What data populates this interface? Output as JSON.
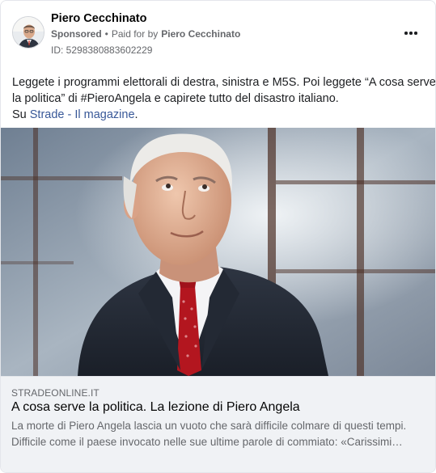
{
  "post": {
    "author": "Piero Cecchinato",
    "sponsored_label": "Sponsored",
    "separator": "•",
    "paid_for_prefix": "Paid for by",
    "paid_for_name": "Piero Cecchinato",
    "ad_id": "ID: 5298380883602229",
    "more_icon": "more-horizontal-icon",
    "text_line_1": "Leggete i programmi elettorali di destra, sinistra e M5S. Poi leggete “A cosa serve",
    "text_line_2": "la politica” di #PieroAngela e capirete tutto del disastro italiano.",
    "text_line_3_prefix": "Su ",
    "text_link": "Strade - Il magazine",
    "text_line_3_suffix": "."
  },
  "link_preview": {
    "domain": "STRADEONLINE.IT",
    "title": "A cosa serve la politica. La lezione di Piero Angela",
    "description_line_1": "La morte di Piero Angela lascia un vuoto che sarà difficile colmare di questi tempi.",
    "description_line_2": "Difficile come il paese invocato nelle sue ultime parole di commiato: «Carissimi…"
  },
  "colors": {
    "link_blue": "#385898",
    "secondary_text": "#65676b",
    "preview_background": "#f0f2f5"
  }
}
